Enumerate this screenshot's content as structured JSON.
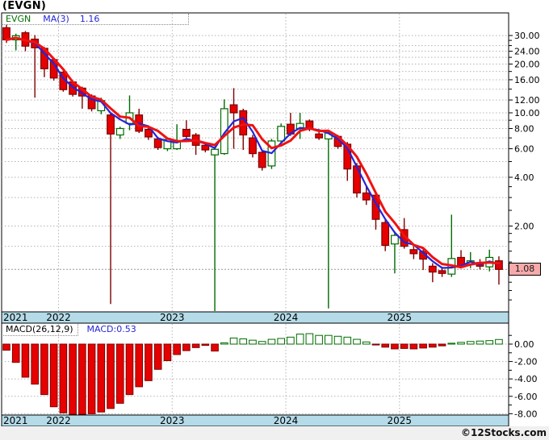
{
  "window_title": "(EVGN)",
  "main_legend": {
    "symbol": "EVGN",
    "ma": "MA(3)",
    "value": "1.16"
  },
  "macd_legend": {
    "label": "MACD(26,12,9)",
    "value": "MACD:0.53"
  },
  "price_tag": "1.08",
  "copyright": "©12Stocks.com",
  "colors": {
    "up": "#006b00",
    "down": "#e60000",
    "down_dark": "#7d0000",
    "ma_fast": "#2424d9",
    "ma_slow": "#ee1212",
    "band": "#b5dbe9",
    "grid": "#b3b3b3",
    "tag_bg": "#f7aaaa",
    "last_price_line": "#999999"
  },
  "chart_data": {
    "type": "candlestick",
    "symbol": "EVGN",
    "scale": "log",
    "title": "(EVGN)",
    "legend_entries": [
      "EVGN",
      "MA(3) 1.16",
      "MACD(26,12,9)",
      "MACD:0.53"
    ],
    "years": [
      {
        "label": "2021",
        "index": 0
      },
      {
        "label": "2022",
        "index": 6
      },
      {
        "label": "2023",
        "index": 18
      },
      {
        "label": "2024",
        "index": 30
      },
      {
        "label": "2025",
        "index": 42
      }
    ],
    "price_axis": {
      "labeled_ticks": [
        30,
        24,
        20,
        16,
        12,
        10,
        8,
        6,
        4,
        2
      ],
      "minor_ticks": [
        28,
        26,
        22,
        18,
        14,
        9,
        7,
        5,
        3.5,
        3,
        2.5,
        1.8,
        1.6,
        1.4,
        1.2,
        1,
        0.9,
        0.8,
        0.7
      ],
      "grid_minor": [
        26,
        22,
        18,
        14,
        9,
        7,
        5,
        3,
        1.5
      ],
      "last_price": 1.08
    },
    "candles": [
      [
        33.5,
        35,
        27,
        28.2
      ],
      [
        28.2,
        30.8,
        24.3,
        29.9
      ],
      [
        31.2,
        32,
        24,
        25.8
      ],
      [
        28.5,
        30.2,
        12.4,
        25.2
      ],
      [
        25,
        25.5,
        16.6,
        18.7
      ],
      [
        21.3,
        21.8,
        15.8,
        16.4
      ],
      [
        17.8,
        18.2,
        13.5,
        13.9
      ],
      [
        15.5,
        15.8,
        12.6,
        13
      ],
      [
        14.2,
        14.5,
        10.6,
        12.7
      ],
      [
        12.7,
        13,
        10.2,
        10.6
      ],
      [
        10.3,
        12.4,
        9.8,
        11.9
      ],
      [
        9.7,
        10,
        0.66,
        7.4
      ],
      [
        7.3,
        8.2,
        6.9,
        8
      ],
      [
        8.6,
        12.8,
        7.8,
        10
      ],
      [
        9.7,
        10.6,
        7.5,
        7.7
      ],
      [
        7.9,
        8.1,
        6.8,
        7.1
      ],
      [
        6.9,
        7.1,
        5.9,
        6.1
      ],
      [
        6,
        7,
        5.8,
        6.85
      ],
      [
        6,
        8.5,
        5.9,
        6.7
      ],
      [
        7.9,
        9,
        7,
        7.15
      ],
      [
        7.3,
        7.5,
        5.5,
        6.3
      ],
      [
        6.3,
        6.5,
        5.7,
        5.9
      ],
      [
        5.5,
        6.2,
        0.59,
        5.95
      ],
      [
        5.6,
        12.1,
        5.5,
        10.6
      ],
      [
        11.2,
        14.2,
        6,
        10
      ],
      [
        10.3,
        10.6,
        5.9,
        7.3
      ],
      [
        7,
        7.3,
        5.3,
        5.6
      ],
      [
        5.7,
        5.9,
        4.4,
        4.6
      ],
      [
        4.7,
        6.9,
        4.5,
        6.7
      ],
      [
        6.7,
        8.6,
        6.5,
        8.25
      ],
      [
        8.5,
        10,
        7.2,
        7.4
      ],
      [
        8,
        10,
        6.9,
        8.6
      ],
      [
        8.9,
        9.1,
        7.7,
        7.9
      ],
      [
        7.4,
        7.6,
        6.8,
        7
      ],
      [
        6.9,
        7.8,
        0.62,
        7.5
      ],
      [
        7.15,
        7.3,
        6,
        6.2
      ],
      [
        6.4,
        6.6,
        3.8,
        4.5
      ],
      [
        4.7,
        4.9,
        3,
        3.2
      ],
      [
        3.2,
        3.5,
        2.7,
        2.9
      ],
      [
        3.1,
        3.2,
        1.9,
        2.2
      ],
      [
        2.1,
        2.2,
        1.4,
        1.52
      ],
      [
        1.55,
        1.85,
        1.02,
        1.75
      ],
      [
        1.9,
        2.24,
        1.45,
        1.5
      ],
      [
        1.43,
        1.5,
        1.25,
        1.35
      ],
      [
        1.39,
        1.45,
        1.07,
        1.25
      ],
      [
        1.13,
        1.18,
        0.9,
        1.04
      ],
      [
        1.06,
        1.12,
        0.97,
        1.02
      ],
      [
        1.01,
        2.35,
        0.97,
        1.26
      ],
      [
        1.28,
        1.42,
        1.1,
        1.13
      ],
      [
        1.16,
        1.38,
        1.1,
        1.22
      ],
      [
        1.19,
        1.25,
        1.08,
        1.13
      ],
      [
        1.12,
        1.43,
        1.05,
        1.28
      ],
      [
        1.22,
        1.3,
        0.87,
        1.08
      ]
    ],
    "ma_fast_period": 3,
    "ma_fast_last": 1.16,
    "macd": {
      "params": "(26,12,9)",
      "last": 0.53,
      "axis_ticks": [
        0,
        -2,
        -4,
        -6,
        -8
      ],
      "minor_ticks": [
        1,
        -1,
        -3,
        -5,
        -7
      ],
      "histogram": [
        -0.7,
        -2.1,
        -3.8,
        -4.6,
        -5.8,
        -7.2,
        -7.9,
        -8.1,
        -8.1,
        -8,
        -7.8,
        -7.4,
        -6.8,
        -5.8,
        -4.9,
        -4.2,
        -2.9,
        -1.9,
        -1.2,
        -0.75,
        -0.4,
        -0.15,
        -0.8,
        0.15,
        0.7,
        0.6,
        0.45,
        0.3,
        0.55,
        0.65,
        0.8,
        1.15,
        1.2,
        1,
        1,
        0.9,
        0.8,
        0.55,
        0.25,
        -0.1,
        -0.35,
        -0.55,
        -0.5,
        -0.55,
        -0.45,
        -0.35,
        -0.2,
        0.1,
        0.2,
        0.3,
        0.35,
        0.4,
        0.53
      ]
    }
  }
}
